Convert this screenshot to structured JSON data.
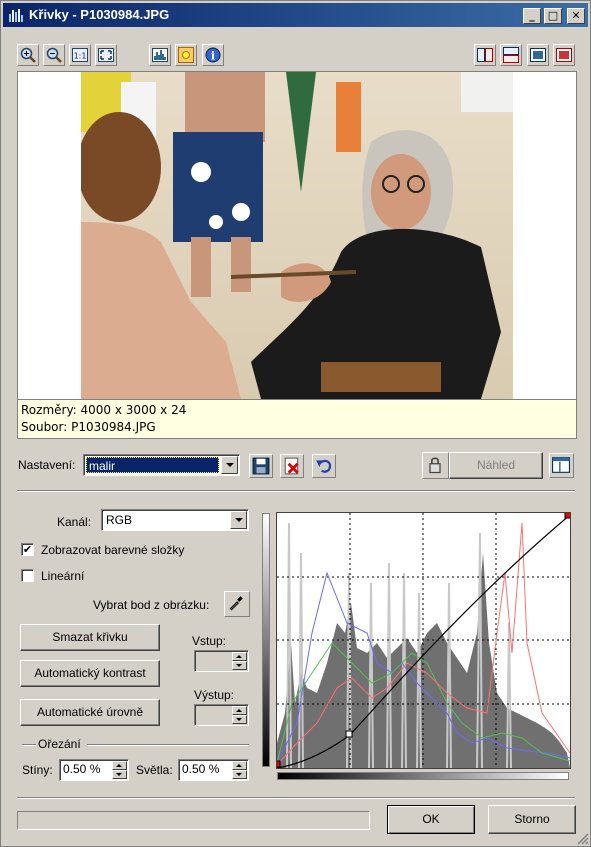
{
  "window": {
    "title": "Křivky - P1030984.JPG",
    "app_icon": "histogram-icon"
  },
  "toolbar": {
    "left_icons": [
      "zoom-in-icon",
      "zoom-out-icon",
      "actual-size-icon",
      "fit-window-icon",
      "histogram-icon",
      "brightness-icon",
      "info-icon"
    ],
    "right_icons": [
      "split-vertical-icon",
      "split-horizontal-icon",
      "view-original-icon",
      "view-result-icon"
    ]
  },
  "preview": {
    "info_dimensions": "Rozměry: 4000 x 3000 x 24",
    "info_file": "Soubor: P1030984.JPG"
  },
  "settings": {
    "label": "Nastavení:",
    "value": "malir",
    "save_icon": "save-icon",
    "delete_icon": "delete-icon",
    "undo_icon": "undo-icon",
    "preview_button": "Náhled",
    "layout_icon": "layout-icon"
  },
  "controls": {
    "channel_label": "Kanál:",
    "channel_value": "RGB",
    "show_color_components": "Zobrazovat barevné složky",
    "show_color_components_checked": true,
    "linear": "Lineární",
    "linear_checked": false,
    "pick_point": "Vybrat bod z obrázku:",
    "clear_curve": "Smazat křivku",
    "auto_contrast": "Automatický kontrast",
    "auto_levels": "Automatické úrovně",
    "input_label": "Vstup:",
    "output_label": "Výstup:",
    "clipping_label": "Ořezání",
    "shadows_label": "Stíny:",
    "shadows_value": "0.50 %",
    "highlights_label": "Světla:",
    "highlights_value": "0.50 %"
  },
  "footer": {
    "ok": "OK",
    "cancel": "Storno"
  }
}
